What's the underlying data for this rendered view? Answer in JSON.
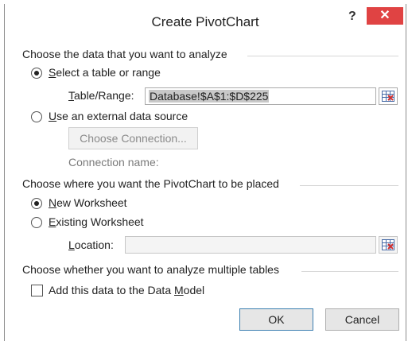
{
  "dialog": {
    "title": "Create PivotChart",
    "help_label": "?",
    "close_label": "✕"
  },
  "data_section": {
    "heading": "Choose the data that you want to analyze",
    "option_table": {
      "accel": "S",
      "rest": "elect a table or range",
      "selected": true
    },
    "table_range": {
      "label_accel": "T",
      "label_rest": "able/Range:",
      "value": "Database!$A$1:$D$225"
    },
    "option_external": {
      "accel": "U",
      "rest": "se an external data source",
      "selected": false
    },
    "choose_connection_label": "Choose Connection...",
    "connection_name_label": "Connection name:"
  },
  "placement_section": {
    "heading": "Choose where you want the PivotChart to be placed",
    "option_new": {
      "accel": "N",
      "rest": "ew Worksheet",
      "selected": true
    },
    "option_existing": {
      "accel": "E",
      "rest": "xisting Worksheet",
      "selected": false
    },
    "location": {
      "label_accel": "L",
      "label_rest": "ocation:",
      "value": ""
    }
  },
  "multi_section": {
    "heading": "Choose whether you want to analyze multiple tables",
    "add_to_model": {
      "before": "Add this data to the Data ",
      "accel": "M",
      "after": "odel",
      "checked": false
    }
  },
  "footer": {
    "ok_label": "OK",
    "cancel_label": "Cancel"
  },
  "icons": {
    "range_picker": "range-picker-icon"
  }
}
